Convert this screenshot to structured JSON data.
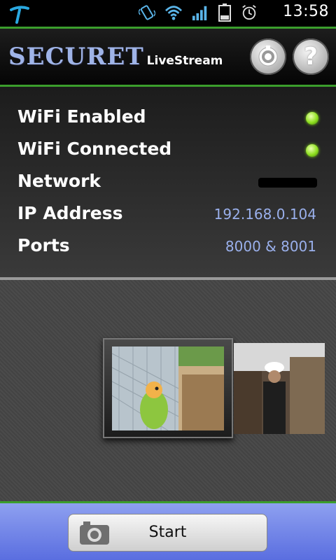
{
  "status_bar": {
    "time": "13:58",
    "battery_level": "28",
    "icons": [
      "carrier-logo-icon",
      "vibrate-icon",
      "wifi-icon",
      "signal-icon",
      "battery-icon",
      "alarm-icon"
    ]
  },
  "header": {
    "logo_main": "SECURET",
    "logo_sub": "LiveStream",
    "settings_icon": "gear-icon",
    "help_label": "?"
  },
  "info": {
    "rows": [
      {
        "label": "WiFi Enabled",
        "indicator": "green-led"
      },
      {
        "label": "WiFi Connected",
        "indicator": "green-led"
      },
      {
        "label": "Network",
        "value": ""
      },
      {
        "label": "IP Address",
        "value": "192.168.0.104"
      },
      {
        "label": "Ports",
        "value": "8000 & 8001"
      }
    ]
  },
  "colors": {
    "accent_green": "#3b9e2c",
    "value_blue": "#9ab0ec",
    "footer_blue": "#6c7fe8"
  },
  "footer": {
    "start_label": "Start"
  }
}
